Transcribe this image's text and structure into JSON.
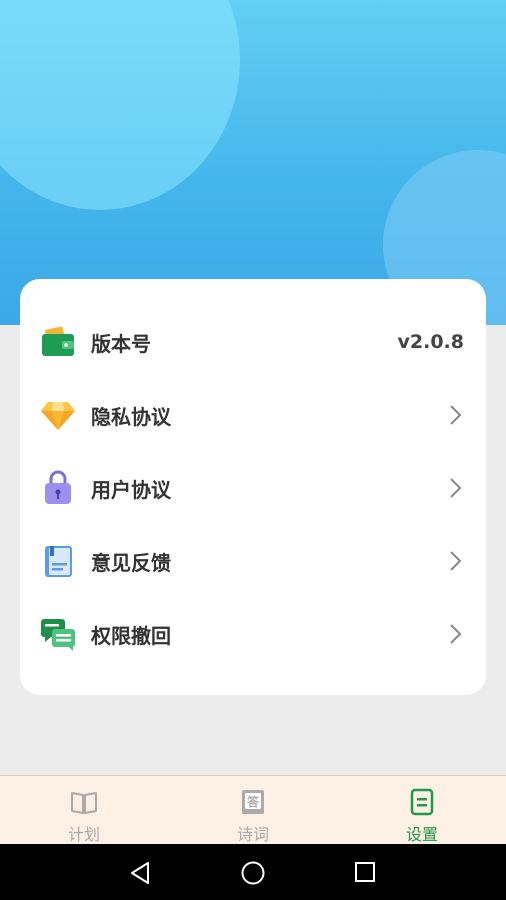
{
  "settings": {
    "items": [
      {
        "label": "版本号",
        "value": "v2.0.8",
        "icon": "wallet-icon"
      },
      {
        "label": "隐私协议",
        "icon": "diamond-icon"
      },
      {
        "label": "用户协议",
        "icon": "lock-bag-icon"
      },
      {
        "label": "意见反馈",
        "icon": "notebook-icon"
      },
      {
        "label": "权限撤回",
        "icon": "chat-icon"
      }
    ]
  },
  "tabs": [
    {
      "label": "计划",
      "icon": "book-icon",
      "active": false
    },
    {
      "label": "诗词",
      "icon": "answer-book-icon",
      "active": false
    },
    {
      "label": "设置",
      "icon": "document-icon",
      "active": true
    }
  ],
  "colors": {
    "active_tab": "#1f9a4a",
    "inactive_tab": "#aaaaaa",
    "header_top": "#62cff3",
    "header_bottom": "#3aa8e6"
  }
}
